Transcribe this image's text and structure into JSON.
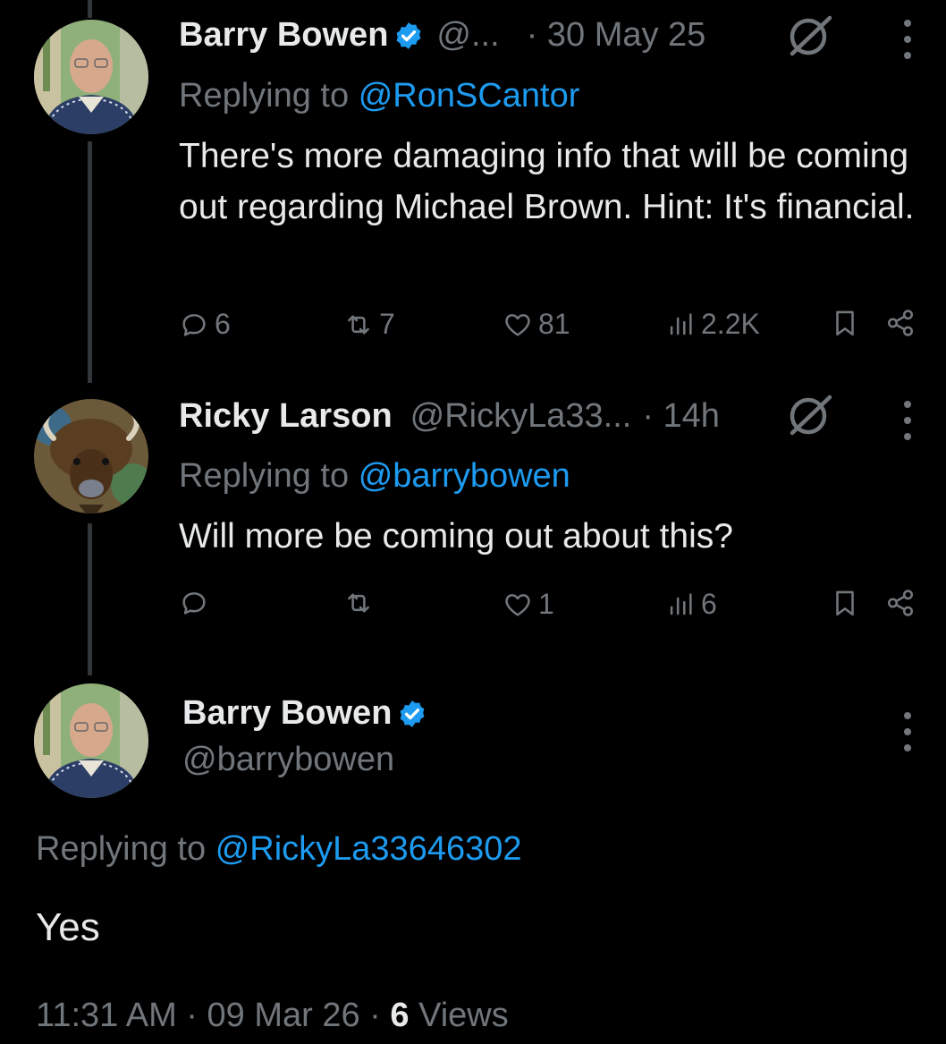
{
  "tweets": [
    {
      "name": "Barry Bowen",
      "handle": "@...",
      "time": "· 30 May 25",
      "reply_label": "Replying to",
      "reply_handle": "@RonSCantor",
      "text": "There's more damaging info that will be coming out regarding Michael Brown. Hint: It's financial.",
      "stats": {
        "replies": "6",
        "reposts": "7",
        "likes": "81",
        "views": "2.2K"
      }
    },
    {
      "name": "Ricky Larson",
      "handle": "@RickyLa33...",
      "time": "· 14h",
      "reply_label": "Replying to",
      "reply_handle": "@barrybowen",
      "text": "Will more be coming out about this?",
      "stats": {
        "replies": "",
        "reposts": "",
        "likes": "1",
        "views": "6"
      }
    }
  ],
  "main_tweet": {
    "name": "Barry Bowen",
    "handle": "@barrybowen",
    "reply_label": "Replying to",
    "reply_handle": "@RickyLa33646302",
    "text": "Yes",
    "timestamp": "11:31 AM · 09 Mar 26 · ",
    "views_count": "6",
    "views_label": " Views"
  },
  "icons": {
    "verified": "verified-badge-icon",
    "grok": "grok-icon",
    "more": "more-options-icon",
    "reply": "reply-icon",
    "repost": "repost-icon",
    "like": "like-icon",
    "views": "views-icon",
    "bookmark": "bookmark-icon",
    "share": "share-icon"
  },
  "colors": {
    "background": "#000000",
    "accent": "#1d9bf0",
    "muted": "#71767b",
    "text": "#e7e9ea"
  }
}
